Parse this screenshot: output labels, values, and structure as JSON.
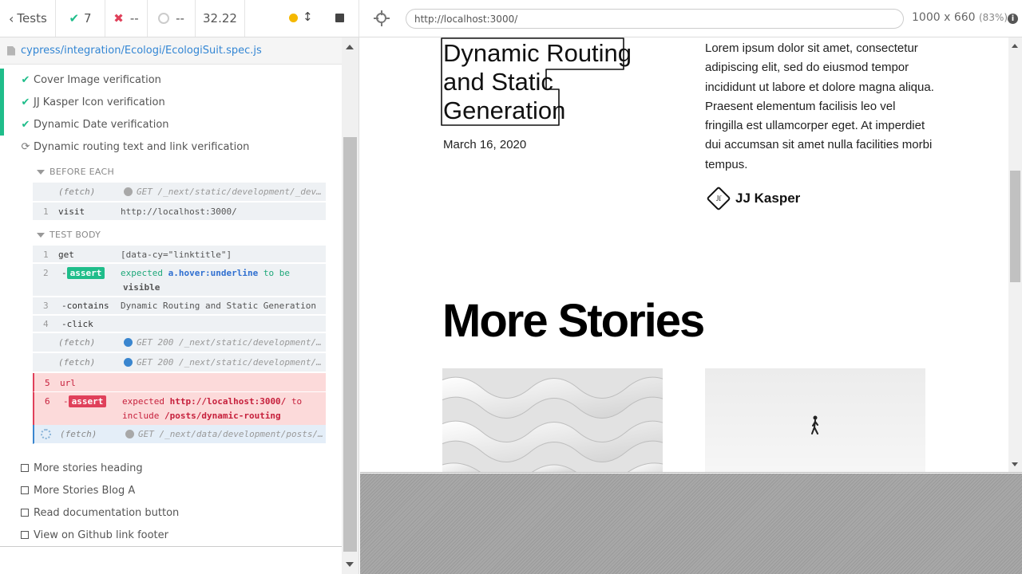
{
  "stats": {
    "tests_label": "Tests",
    "passed": "7",
    "failed": "--",
    "pending": "--",
    "duration": "32.22"
  },
  "spec": {
    "path": "cypress/integration/Ecologi/EcologiSuit.spec.js"
  },
  "tests": {
    "t1": "Cover Image verification",
    "t2": "JJ Kasper Icon verification",
    "t3": "Dynamic Date verification",
    "t4": "Dynamic routing text and link verification",
    "t5": "More stories heading",
    "t6": "More Stories Blog A",
    "t7": "Read documentation button",
    "t8": "View on Github link footer"
  },
  "hooks": {
    "before_each": "BEFORE EACH",
    "test_body": "TEST BODY"
  },
  "commands": {
    "b0": {
      "name": "(fetch)",
      "msg": "GET /_next/static/development/_dev…"
    },
    "b1": {
      "num": "1",
      "name": "visit",
      "msg": "http://localhost:3000/"
    },
    "c1": {
      "num": "1",
      "name": "get",
      "msg": "[data-cy=\"linktitle\"]"
    },
    "c2": {
      "num": "2",
      "name": "-assert",
      "badge": "assert",
      "expected": "expected",
      "subject": "a.hover:underline",
      "tobe": "to be",
      "value": "visible"
    },
    "c3": {
      "num": "3",
      "name": "-contains",
      "msg": "Dynamic Routing and Static Generation"
    },
    "c4": {
      "num": "4",
      "name": "-click"
    },
    "f1": {
      "name": "(fetch)",
      "msg": "GET 200 /_next/static/development/…"
    },
    "f2": {
      "name": "(fetch)",
      "msg": "GET 200 /_next/static/development/…"
    },
    "c5": {
      "num": "5",
      "name": "url"
    },
    "c6": {
      "num": "6",
      "badge": "assert",
      "expected": "expected",
      "subject": "http://localhost:3000/",
      "to": "to",
      "include": "include",
      "value": "/posts/dynamic-routing"
    },
    "f3": {
      "name": "(fetch)",
      "msg": "GET /_next/data/development/posts/…"
    }
  },
  "aut": {
    "url": "http://localhost:3000/",
    "viewport": "1000 x 660",
    "scale": "(83%)"
  },
  "page": {
    "title": "Dynamic Routing and Static Generation",
    "date": "March 16, 2020",
    "excerpt": "Lorem ipsum dolor sit amet, consectetur adipiscing elit, sed do eiusmod tempor incididunt ut labore et dolore magna aliqua. Praesent elementum facilisis leo vel fringilla est ullamcorper eget. At imperdiet dui accumsan sit amet nulla facilities morbi tempus.",
    "author": "JJ Kasper",
    "more_stories": "More Stories"
  },
  "colors": {
    "pass": "#1fbd8a",
    "fail": "#e0405a",
    "link": "#3386d4"
  }
}
